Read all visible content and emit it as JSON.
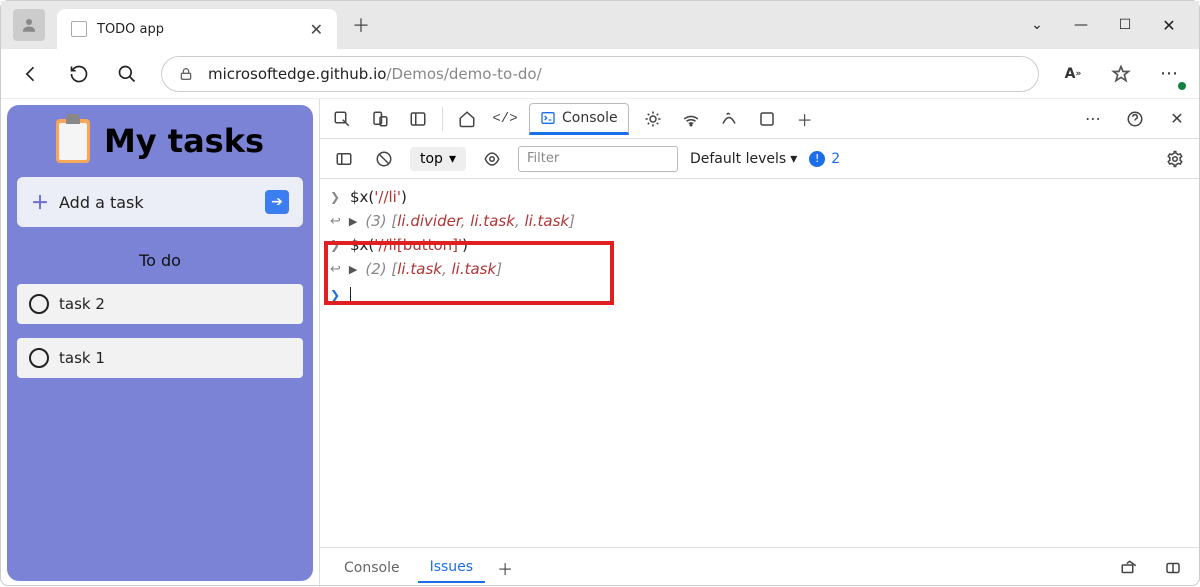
{
  "browser": {
    "tab_title": "TODO app",
    "url_prefix": "microsoftedge.github.io",
    "url_rest": "/Demos/demo-to-do/"
  },
  "todo": {
    "title": "My tasks",
    "add_label": "Add a task",
    "section": "To do",
    "tasks": [
      "task 2",
      "task 1"
    ]
  },
  "devtools": {
    "active_tab": "Console",
    "context": "top",
    "filter_placeholder": "Filter",
    "levels": "Default levels",
    "issues_count": "2",
    "gear_label": "",
    "lines": [
      {
        "kind": "input",
        "pre": "$x(",
        "str": "'//li'",
        "post": ")"
      },
      {
        "kind": "output",
        "count": "(3)",
        "items": [
          "li.divider",
          "li.task",
          "li.task"
        ]
      },
      {
        "kind": "input",
        "pre": "$x(",
        "str": "'//li[button]'",
        "post": ")"
      },
      {
        "kind": "output",
        "count": "(2)",
        "items": [
          "li.task",
          "li.task"
        ]
      }
    ],
    "footer": {
      "console": "Console",
      "issues": "Issues"
    }
  }
}
